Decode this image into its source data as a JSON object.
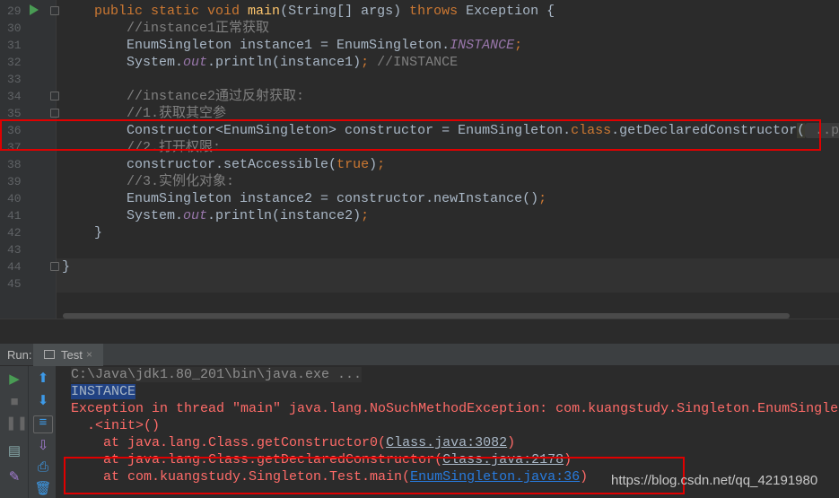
{
  "editor": {
    "line_numbers": [
      "29",
      "30",
      "31",
      "32",
      "33",
      "34",
      "35",
      "36",
      "37",
      "38",
      "39",
      "40",
      "41",
      "42",
      "43",
      "44",
      "45"
    ],
    "lines": [
      [
        {
          "t": "    "
        },
        {
          "t": "public static void ",
          "c": "kw"
        },
        {
          "t": "main",
          "c": "fn"
        },
        {
          "t": "(String[] args) "
        },
        {
          "t": "throws ",
          "c": "kw"
        },
        {
          "t": "Exception {"
        }
      ],
      [
        {
          "t": "        "
        },
        {
          "t": "//instance1正常获取",
          "c": "cm"
        }
      ],
      [
        {
          "t": "        EnumSingleton instance1 = EnumSingleton."
        },
        {
          "t": "INSTANCE",
          "c": "st"
        },
        {
          "t": ";",
          "c": "kw"
        }
      ],
      [
        {
          "t": "        System."
        },
        {
          "t": "out",
          "c": "st"
        },
        {
          "t": ".println(instance1)"
        },
        {
          "t": "; ",
          "c": "kw"
        },
        {
          "t": "//INSTANCE",
          "c": "cm"
        }
      ],
      [],
      [
        {
          "t": "        "
        },
        {
          "t": "//instance2通过反射获取:",
          "c": "cm"
        }
      ],
      [
        {
          "t": "        "
        },
        {
          "t": "//1.获取其空参",
          "c": "cm"
        }
      ],
      [
        {
          "t": "        Constructor<EnumSingleton> constructor = EnumSingleton."
        },
        {
          "t": "class",
          "c": "kw"
        },
        {
          "t": ".getDeclaredConstructor"
        },
        {
          "t": "(",
          "c": "paren"
        },
        {
          "t": " ..pa",
          "c": "hint"
        }
      ],
      [
        {
          "t": "        "
        },
        {
          "t": "//2.打开权限:",
          "c": "cm"
        }
      ],
      [
        {
          "t": "        constructor.setAccessible("
        },
        {
          "t": "true",
          "c": "kw"
        },
        {
          "t": ")"
        },
        {
          "t": ";",
          "c": "kw"
        }
      ],
      [
        {
          "t": "        "
        },
        {
          "t": "//3.实例化对象:",
          "c": "cm"
        }
      ],
      [
        {
          "t": "        EnumSingleton instance2 = constructor.newInstance()"
        },
        {
          "t": ";",
          "c": "kw"
        }
      ],
      [
        {
          "t": "        System."
        },
        {
          "t": "out",
          "c": "st"
        },
        {
          "t": ".println(instance2)"
        },
        {
          "t": ";",
          "c": "kw"
        }
      ],
      [
        {
          "t": "    }"
        }
      ],
      [],
      [
        {
          "t": "}"
        }
      ],
      []
    ]
  },
  "run_panel": {
    "label": "Run:",
    "tab": "Test",
    "tab_close": "×",
    "output": [
      [
        {
          "t": "C:\\Java\\jdk1.80_201\\bin\\java.exe ...",
          "c": "gray"
        }
      ],
      [
        {
          "t": "INSTANCE",
          "c": "sel"
        }
      ],
      [
        {
          "t": "Exception in thread \"main\" java.lang.NoSuchMethodException: com.kuangstudy.Singleton.EnumSinglet"
        }
      ],
      [
        {
          "t": "  .<init>()"
        }
      ],
      [
        {
          "t": "    at java.lang.Class.getConstructor0("
        },
        {
          "t": "Class.java:3082",
          "c": "u"
        },
        {
          "t": ")"
        }
      ],
      [
        {
          "t": "    at java.lang.Class.getDeclaredConstructor("
        },
        {
          "t": "Class.java:2178",
          "c": "u"
        },
        {
          "t": ")"
        }
      ],
      [
        {
          "t": "    at com.kuangstudy.Singleton.Test.main("
        },
        {
          "t": "EnumSingleton.java:36",
          "c": "lnk"
        },
        {
          "t": ")"
        }
      ]
    ]
  },
  "watermark": "https://blog.csdn.net/qq_42191980",
  "colors": {
    "highlight_box": "#e00000",
    "keyword": "#cc7832",
    "error": "#ff6b68",
    "link": "#287bde"
  }
}
